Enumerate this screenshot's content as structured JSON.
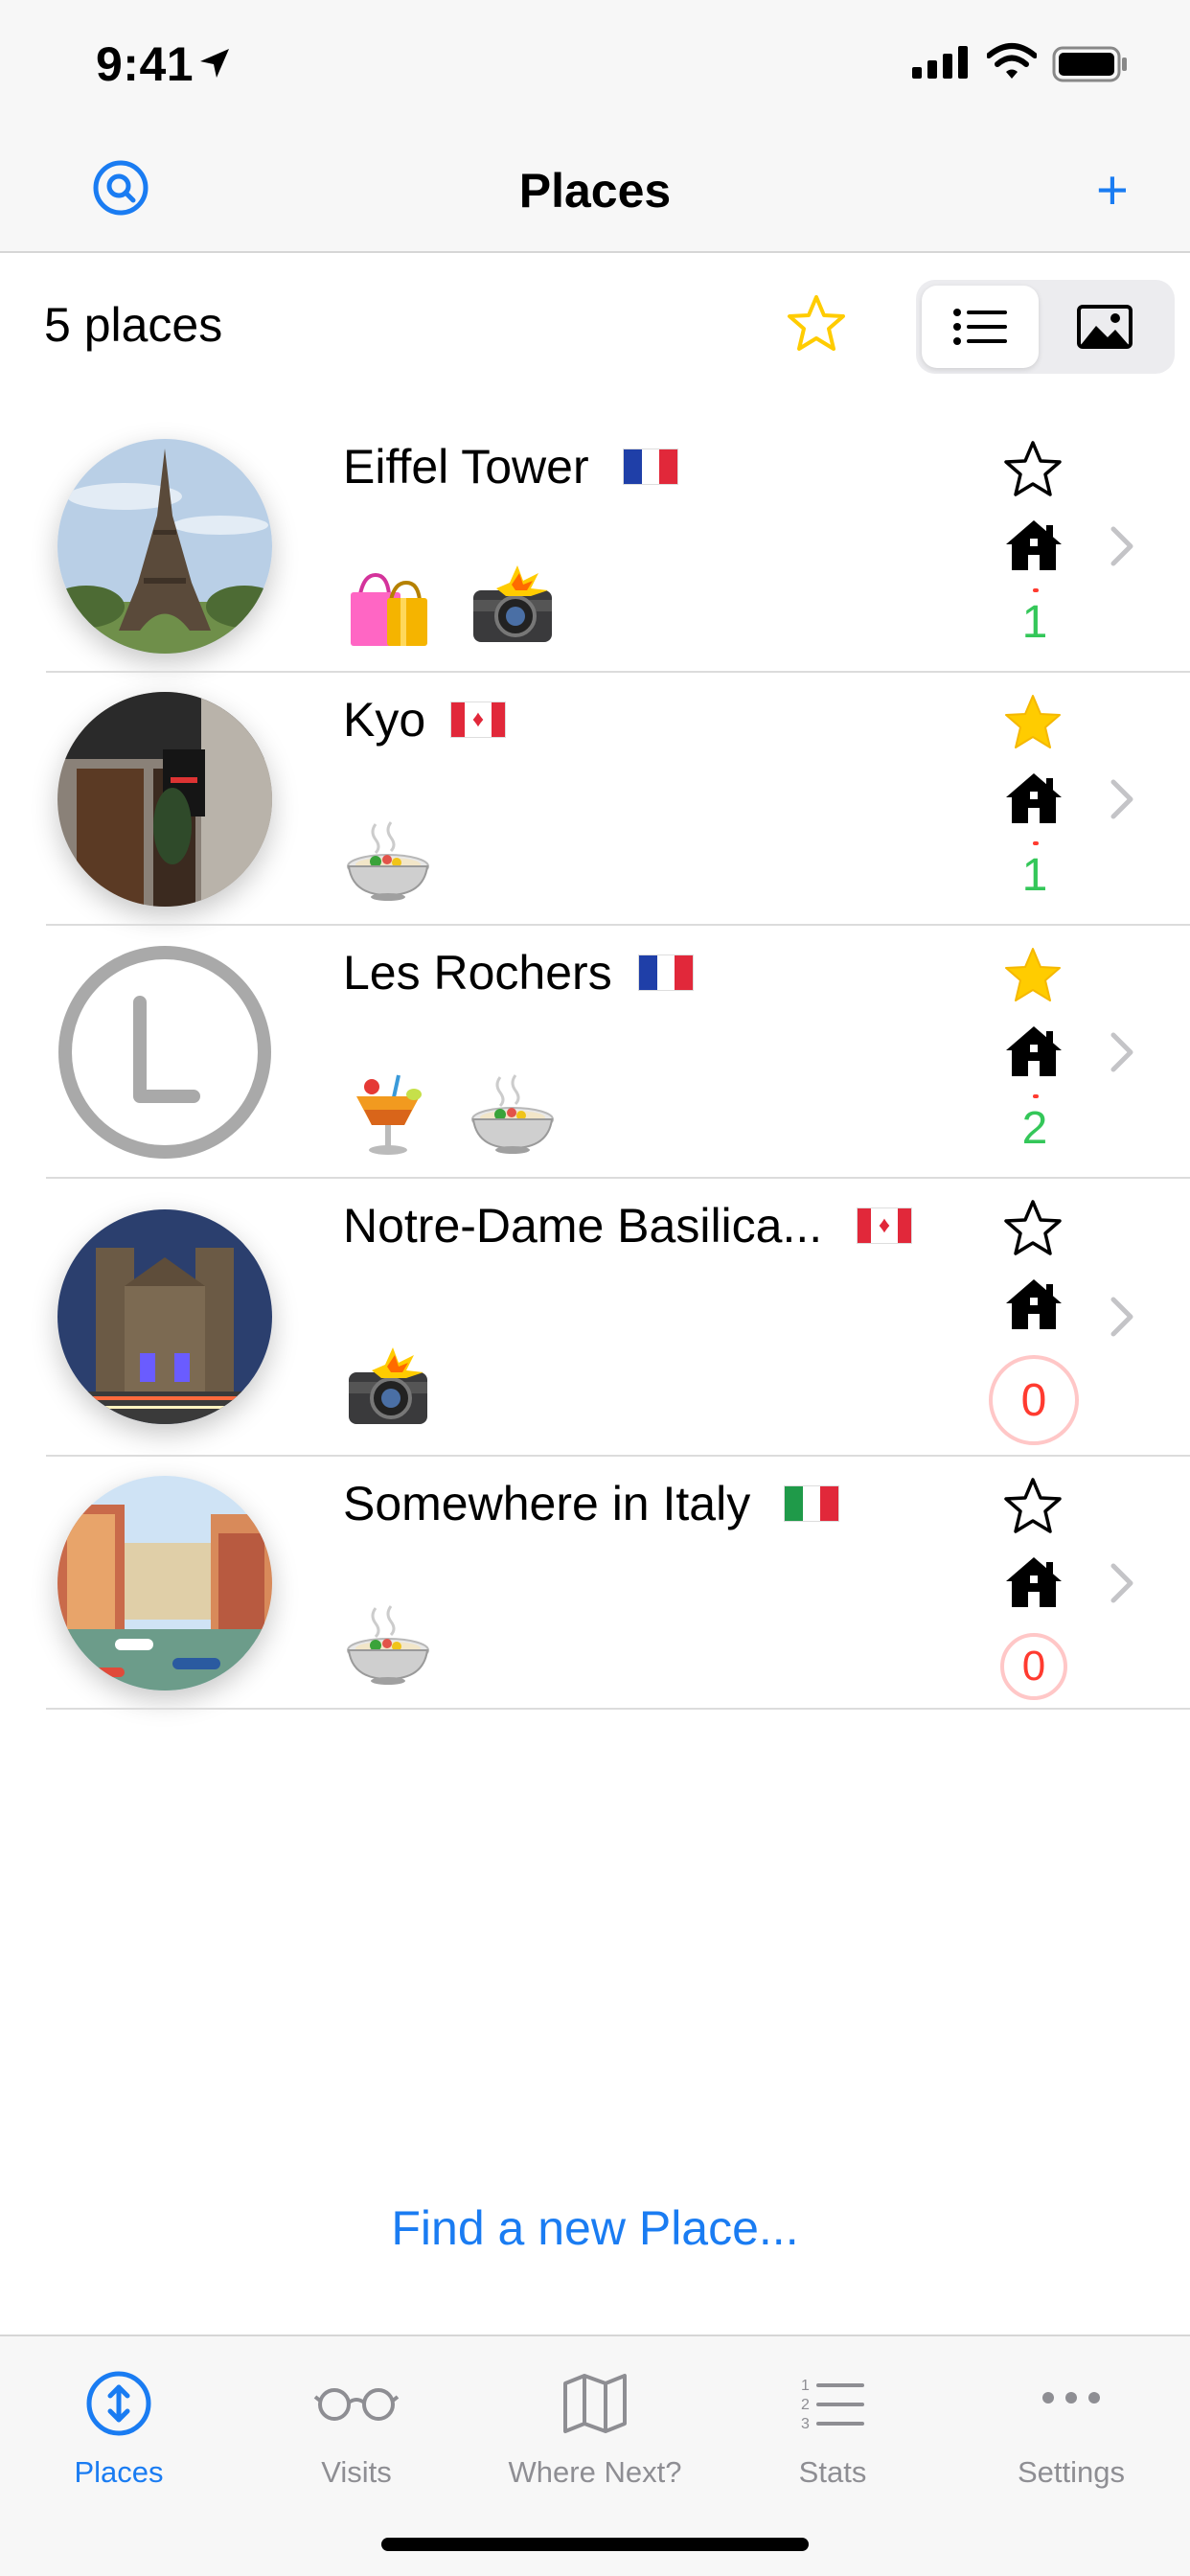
{
  "status_bar": {
    "time": "9:41"
  },
  "nav": {
    "title": "Places",
    "add_label": "+"
  },
  "toolbar": {
    "count_label": "5 places",
    "view_modes": [
      "list",
      "photo"
    ]
  },
  "colors": {
    "accent": "#1a7cf2",
    "favorite": "#ffcc00",
    "visits_green": "#34c759",
    "zero_red": "#ff3b30"
  },
  "places": [
    {
      "name": "Eiffel Tower",
      "flag": "France",
      "categories": [
        "shopping",
        "photo"
      ],
      "favorite": false,
      "visits": "1"
    },
    {
      "name": "Kyo",
      "flag": "Canada",
      "categories": [
        "food"
      ],
      "favorite": true,
      "visits": "1"
    },
    {
      "name": "Les Rochers",
      "flag": "France",
      "categories": [
        "drinks",
        "food"
      ],
      "favorite": true,
      "visits": "2",
      "avatar_letter": "L"
    },
    {
      "name": "Notre-Dame Basilica...",
      "flag": "Canada",
      "categories": [
        "photo"
      ],
      "favorite": false,
      "visits": "0"
    },
    {
      "name": "Somewhere in Italy",
      "flag": "Italy",
      "categories": [
        "food"
      ],
      "favorite": false,
      "visits": "0"
    }
  ],
  "find_link": "Find a new Place...",
  "tabs": [
    {
      "label": "Places",
      "icon": "places-icon",
      "active": true
    },
    {
      "label": "Visits",
      "icon": "glasses-icon",
      "active": false
    },
    {
      "label": "Where Next?",
      "icon": "map-icon",
      "active": false
    },
    {
      "label": "Stats",
      "icon": "numbered-list-icon",
      "active": false
    },
    {
      "label": "Settings",
      "icon": "more-icon",
      "active": false
    }
  ]
}
